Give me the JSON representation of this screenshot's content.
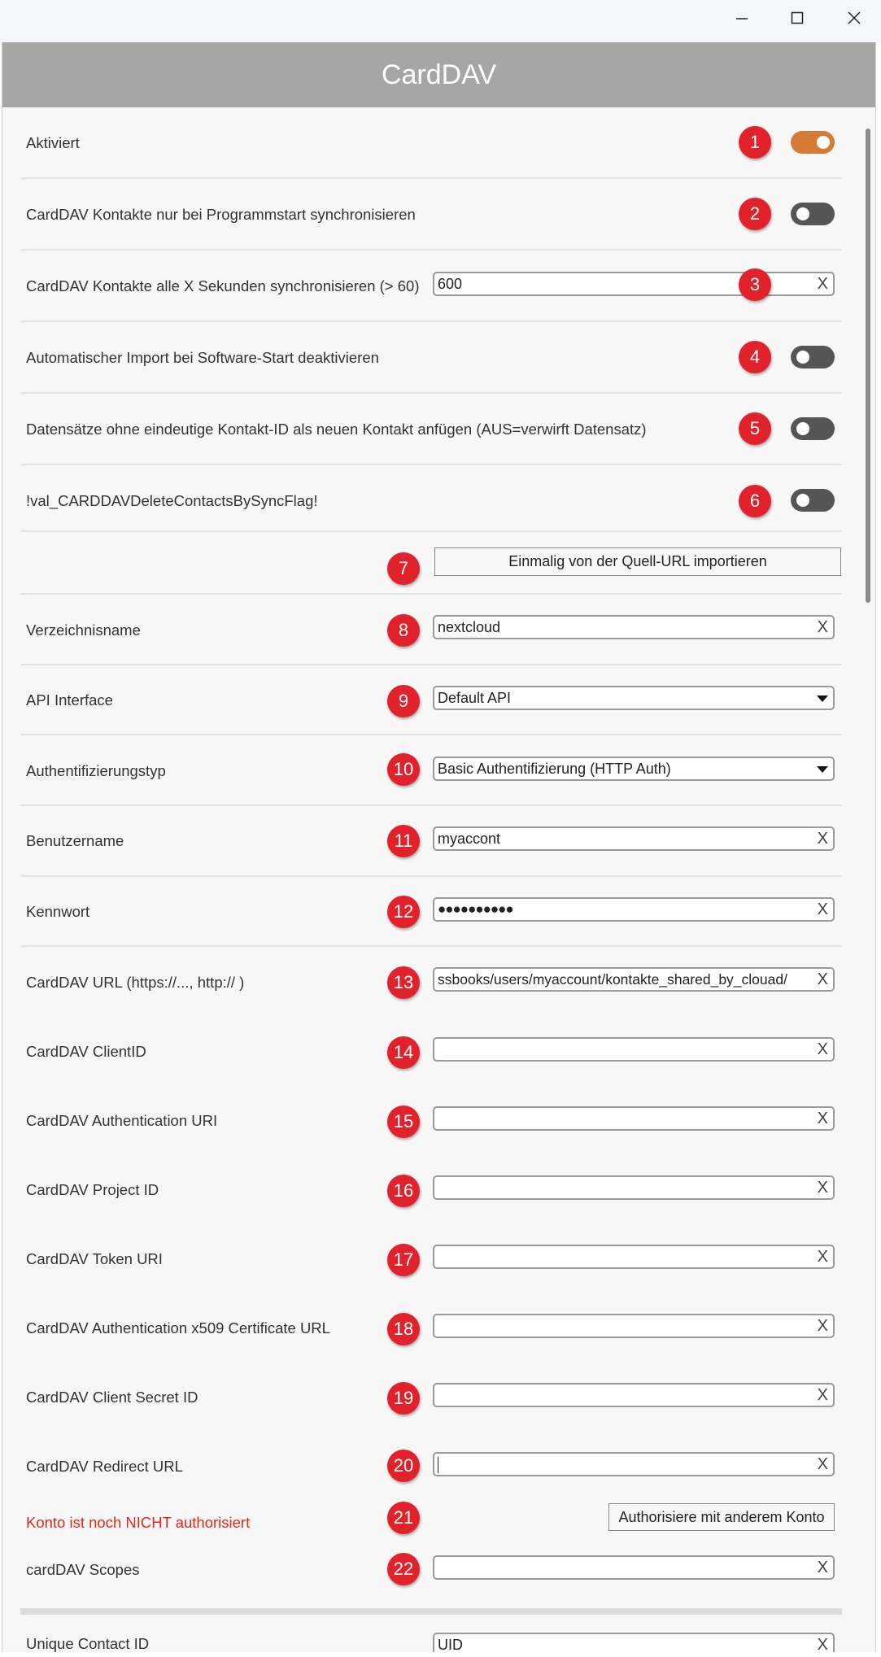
{
  "window": {
    "minimize_icon": "minimize-icon",
    "maximize_icon": "maximize-icon",
    "close_icon": "close-icon"
  },
  "header": {
    "title": "CardDAV"
  },
  "accent_color": "#d67a38",
  "badge_color": "#e2222a",
  "settings": {
    "activated": {
      "label": "Aktiviert",
      "badge": "1",
      "state": "on"
    },
    "sync_on_start": {
      "label": "CardDAV Kontakte nur bei Programmstart synchronisieren",
      "badge": "2",
      "state": "off"
    },
    "sync_interval": {
      "label": "CardDAV Kontakte alle X Sekunden synchronisieren (> 60)",
      "badge": "3",
      "value": "600",
      "clear": "X"
    },
    "disable_auto_import": {
      "label": "Automatischer Import bei Software-Start deaktivieren",
      "badge": "4",
      "state": "off"
    },
    "append_records": {
      "label": "Datensätze ohne eindeutige Kontakt-ID als neuen Kontakt anfügen (AUS=verwirft Datensatz)",
      "badge": "5",
      "state": "off"
    },
    "delete_by_flag": {
      "label": "!val_CARDDAVDeleteContactsBySyncFlag!",
      "badge": "6",
      "state": "off"
    },
    "import_once": {
      "button": "Einmalig von der Quell-URL importieren",
      "badge": "7"
    },
    "directory_name": {
      "label": "Verzeichnisname",
      "badge": "8",
      "value": "nextcloud",
      "clear": "X"
    },
    "api_interface": {
      "label": "API Interface",
      "badge": "9",
      "value": "Default API"
    },
    "auth_type": {
      "label": "Authentifizierungstyp",
      "badge": "10",
      "value": "Basic Authentifizierung (HTTP Auth)"
    },
    "username": {
      "label": "Benutzername",
      "badge": "11",
      "value": "myaccont",
      "clear": "X"
    },
    "password": {
      "label": "Kennwort",
      "badge": "12",
      "value": "●●●●●●●●●●",
      "clear": "X"
    },
    "url": {
      "label": "CardDAV URL (https://..., http:// )",
      "badge": "13",
      "value": "ssbooks/users/myaccount/kontakte_shared_by_clouad/",
      "clear": "X"
    },
    "client_id": {
      "label": "CardDAV ClientID",
      "badge": "14",
      "value": "",
      "clear": "X"
    },
    "auth_uri": {
      "label": "CardDAV Authentication URI",
      "badge": "15",
      "value": "",
      "clear": "X"
    },
    "project_id": {
      "label": "CardDAV Project ID",
      "badge": "16",
      "value": "",
      "clear": "X"
    },
    "token_uri": {
      "label": "CardDAV Token URI",
      "badge": "17",
      "value": "",
      "clear": "X"
    },
    "x509_url": {
      "label": "CardDAV Authentication x509 Certificate URL",
      "badge": "18",
      "value": "",
      "clear": "X"
    },
    "client_secret": {
      "label": "CardDAV Client Secret ID",
      "badge": "19",
      "value": "",
      "clear": "X"
    },
    "redirect_url": {
      "label": "CardDAV Redirect URL",
      "badge": "20",
      "value": "",
      "clear": "X"
    },
    "auth_status": {
      "label": "Konto ist noch NICHT authorisiert",
      "badge": "21",
      "button": "Authorisiere mit anderem Konto"
    },
    "scopes": {
      "label": "cardDAV Scopes",
      "badge": "22",
      "value": "",
      "clear": "X"
    },
    "unique_contact_id": {
      "label": "Unique Contact ID",
      "value": "UID",
      "clear": "X"
    }
  }
}
